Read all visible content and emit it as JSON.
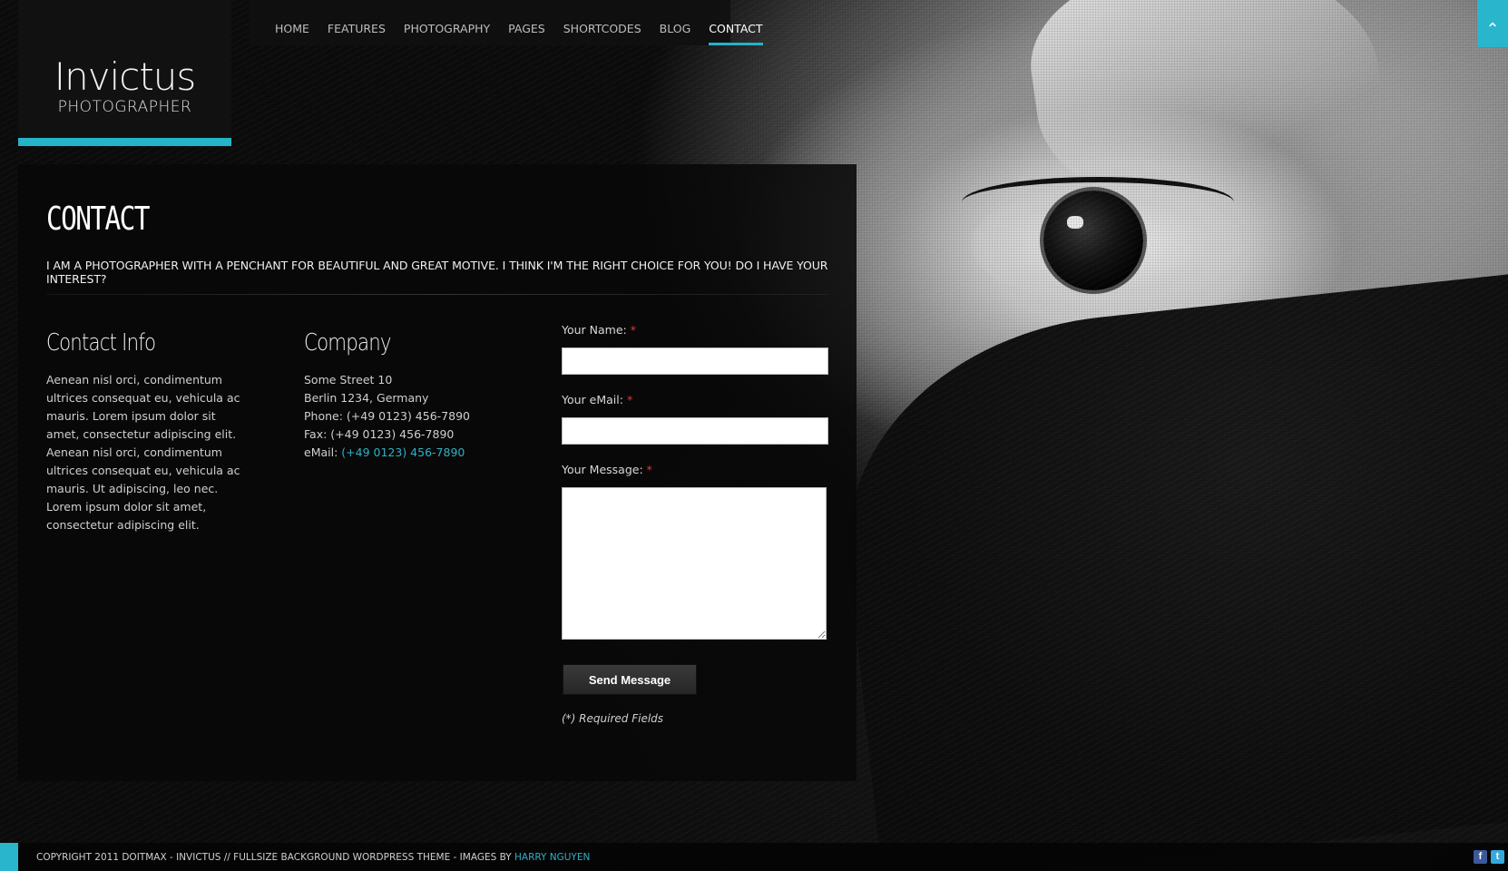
{
  "logo": {
    "name": "Invictus",
    "subtitle": "PHOTOGRAPHER"
  },
  "nav": {
    "items": [
      {
        "label": "HOME"
      },
      {
        "label": "FEATURES"
      },
      {
        "label": "PHOTOGRAPHY"
      },
      {
        "label": "PAGES"
      },
      {
        "label": "SHORTCODES"
      },
      {
        "label": "BLOG"
      },
      {
        "label": "CONTACT",
        "active": true
      }
    ]
  },
  "scroll_top": {
    "icon": "chevron-up-icon",
    "glyph": "^"
  },
  "page": {
    "title": "CONTACT",
    "intro": "I AM A PHOTOGRAPHER WITH A PENCHANT FOR BEAUTIFUL AND GREAT MOTIVE. I THINK I'M THE RIGHT CHOICE FOR YOU! DO I HAVE YOUR INTEREST?"
  },
  "contact_info": {
    "heading": "Contact Info",
    "text": "Aenean nisl orci, condimentum ultrices consequat eu, vehicula ac mauris. Lorem ipsum dolor sit amet, consectetur adipiscing elit. Aenean nisl orci, condimentum ultrices consequat eu, vehicula ac mauris. Ut adipiscing, leo nec. Lorem ipsum dolor sit amet, consectetur adipiscing elit."
  },
  "company": {
    "heading": "Company",
    "street": "Some Street 10",
    "city": "Berlin 1234, Germany",
    "phone": "Phone: (+49 0123) 456-7890",
    "fax": "Fax: (+49 0123) 456-7890",
    "email_label": "eMail: ",
    "email_value": "(+49 0123) 456-7890"
  },
  "form": {
    "name_label": "Your Name: ",
    "email_label": "Your eMail: ",
    "message_label": "Your Message: ",
    "required_mark": "*",
    "name_value": "",
    "email_value": "",
    "message_value": "",
    "send_label": "Send Message",
    "required_note": "(*) Required Fields"
  },
  "footer": {
    "copyright": "COPYRIGHT 2011 DOITMAX - INVICTUS // FULLSIZE BACKGROUND WORDPRESS THEME - IMAGES BY ",
    "credit_link": "HARRY NGUYEN",
    "social": [
      {
        "name": "facebook-icon",
        "glyph": "f"
      },
      {
        "name": "twitter-icon",
        "glyph": "t"
      }
    ]
  },
  "colors": {
    "accent": "#29b6cc",
    "required": "#e23a3a",
    "panel": "#080808"
  }
}
